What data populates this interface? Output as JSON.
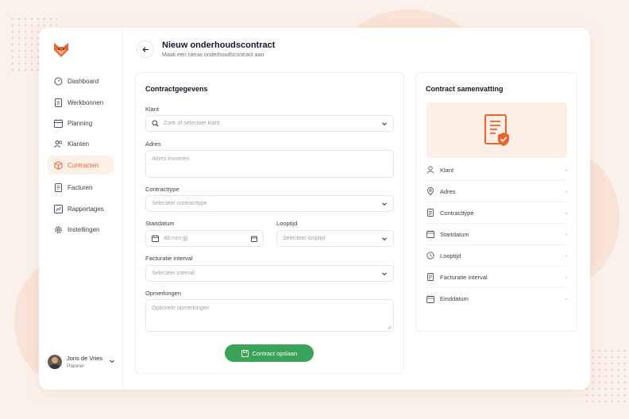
{
  "app": {
    "accent": "#e8662d",
    "success": "#3aa35a"
  },
  "sidebar": {
    "items": [
      {
        "label": "Dashboard",
        "icon": "dashboard-icon",
        "active": false
      },
      {
        "label": "Werkbonnen",
        "icon": "document-icon",
        "active": false
      },
      {
        "label": "Planning",
        "icon": "calendar-icon",
        "active": false
      },
      {
        "label": "Klanten",
        "icon": "users-icon",
        "active": false
      },
      {
        "label": "Contracten",
        "icon": "box-icon",
        "active": true
      },
      {
        "label": "Facturen",
        "icon": "invoice-icon",
        "active": false
      },
      {
        "label": "Rapportages",
        "icon": "chart-icon",
        "active": false
      },
      {
        "label": "Instellingen",
        "icon": "gear-icon",
        "active": false
      }
    ],
    "user": {
      "name": "Joris de Vries",
      "role": "Planner"
    }
  },
  "header": {
    "title": "Nieuw onderhoudscontract",
    "subtitle": "Maak een nieuw onderhoudscontract aan"
  },
  "form": {
    "title": "Contractgegevens",
    "klant": {
      "label": "Klant",
      "placeholder": "Zoek of selecteer klant"
    },
    "adres": {
      "label": "Adres",
      "placeholder": "Adres invoeren"
    },
    "contracttype": {
      "label": "Contracttype",
      "placeholder": "Selecteer contracttype"
    },
    "startdatum": {
      "label": "Startdatum",
      "placeholder": "dd-mm-jjjj"
    },
    "looptijd": {
      "label": "Looptijd",
      "placeholder": "Selecteer looptijd"
    },
    "interval": {
      "label": "Facturatie interval",
      "placeholder": "Selecteer interval"
    },
    "opmerkingen": {
      "label": "Opmerkingen",
      "placeholder": "Optionele opmerkingen"
    },
    "save_label": "Contract opslaan"
  },
  "summary": {
    "title": "Contract samenvatting",
    "rows": [
      {
        "label": "Klant",
        "value": "-",
        "icon": "user-icon"
      },
      {
        "label": "Adres",
        "value": "-",
        "icon": "location-icon"
      },
      {
        "label": "Contracttype",
        "value": "-",
        "icon": "document-icon"
      },
      {
        "label": "Startdatum",
        "value": "-",
        "icon": "calendar-icon"
      },
      {
        "label": "Looptijd",
        "value": "-",
        "icon": "clock-icon"
      },
      {
        "label": "Facturatie interval",
        "value": "-",
        "icon": "invoice-icon"
      },
      {
        "label": "Einddatum",
        "value": "-",
        "icon": "calendar-icon"
      }
    ]
  }
}
